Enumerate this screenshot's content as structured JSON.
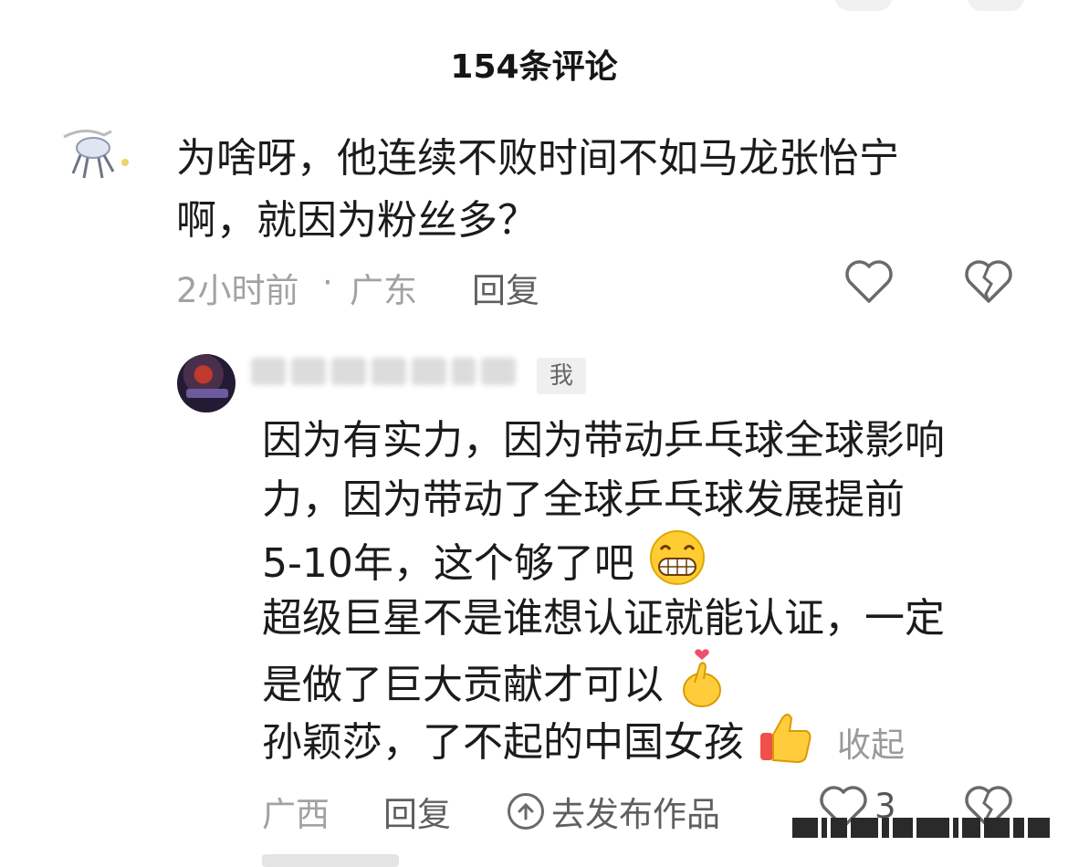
{
  "header": {
    "title": "154条评论"
  },
  "comment1": {
    "lines": [
      "为啥呀，他连续不败时间不如马龙张怡宁",
      "啊，就因为粉丝多？"
    ],
    "time": "2小时前",
    "separator": "·",
    "location": "广东",
    "reply_label": "回复"
  },
  "comment2": {
    "me_badge": "我",
    "lines": [
      "因为有实力，因为带动乒乓球全球影响",
      "力，因为带动了全球乒乓球发展提前",
      "5-10年，这个够了吧",
      "超级巨星不是谁想认证就能认证，一定",
      "是做了巨大贡献才可以",
      "孙颖莎，了不起的中国女孩"
    ],
    "collapse_label": "收起",
    "location": "广西",
    "reply_label": "回复",
    "publish_label": "去发布作品",
    "like_count": "3"
  },
  "icons": {
    "like": "heart-outline-icon",
    "dislike": "broken-heart-icon",
    "grin": "grinning-emoji-icon",
    "finger_heart": "finger-heart-emoji-icon",
    "thumbs_up": "thumbs-up-emoji-icon",
    "publish": "arrow-up-circle-icon"
  },
  "colors": {
    "text": "#1b1b1b",
    "meta": "#a2a2a2",
    "link": "#5f5f5f",
    "icon": "#6a6a6a"
  }
}
